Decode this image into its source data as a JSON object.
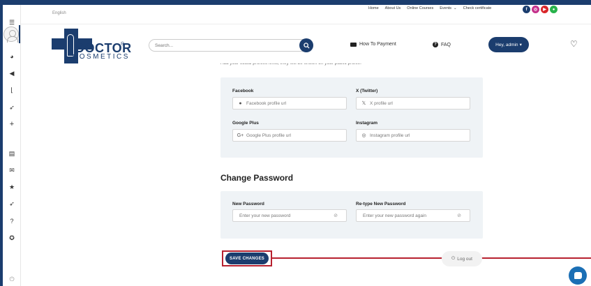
{
  "topbar": {
    "language": "English",
    "links": [
      "Home",
      "About Us",
      "Online Courses",
      "Events",
      "Check certificate"
    ],
    "events_chevron": "chevron-down-icon"
  },
  "socials": [
    {
      "icon": "facebook-icon",
      "glyph": "f",
      "color": "#1b3d6e"
    },
    {
      "icon": "instagram-icon",
      "glyph": "◎",
      "color": "#c42f8a"
    },
    {
      "icon": "youtube-icon",
      "glyph": "▶",
      "color": "#d9252a"
    },
    {
      "icon": "line-icon",
      "glyph": "●",
      "color": "#27b24a"
    }
  ],
  "logo": {
    "word1": "DOCTOR",
    "reg": "®",
    "word2": "COSMETICS"
  },
  "header": {
    "search_placeholder": "Search...",
    "payment_label": "How To Payment",
    "faq_label": "FAQ",
    "user_label": "Hey, admin",
    "user_caret": "▾"
  },
  "intro_text": "Add your social profiles links, they will be shown on your public profile.",
  "social_section": {
    "facebook": {
      "label": "Facebook",
      "placeholder": "Facebook profile url"
    },
    "twitter": {
      "label": "X (Twitter)",
      "placeholder": "X profile url"
    },
    "google": {
      "label": "Google Plus",
      "placeholder": "Google Plus profile url"
    },
    "instagram": {
      "label": "Instagram",
      "placeholder": "Instagram profile url"
    }
  },
  "password_section": {
    "title": "Change Password",
    "new_label": "New Password",
    "new_placeholder": "Enter your new password",
    "retype_label": "Re-type New Password",
    "retype_placeholder": "Enter your new password again"
  },
  "actions": {
    "save": "SAVE CHANGES",
    "logout": "Log out"
  },
  "colors": {
    "brand": "#1b3d6e",
    "highlight": "#b7212f",
    "panel": "#eff3f6"
  },
  "sidebar_icons": [
    "menu-icon",
    "avatar",
    "dashboard-icon",
    "megaphone-icon",
    "chart-icon",
    "rocket-icon",
    "plus-icon",
    "book-icon",
    "mail-icon",
    "star-icon",
    "rocket-icon",
    "help-icon",
    "award-icon",
    "power-icon"
  ]
}
